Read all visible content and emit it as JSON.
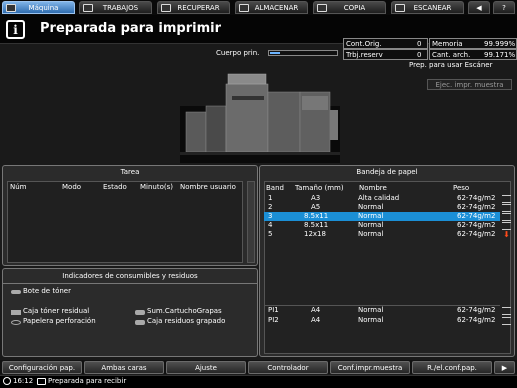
{
  "tabs": [
    {
      "label": "Máquina",
      "icon": "machine-icon"
    },
    {
      "label": "TRABAJOS",
      "icon": "jobs-icon"
    },
    {
      "label": "RECUPERAR",
      "icon": "recall-icon"
    },
    {
      "label": "ALMACENAR",
      "icon": "store-icon"
    },
    {
      "label": "COPIA",
      "icon": "copy-icon"
    },
    {
      "label": "ESCANEAR",
      "icon": "scan-icon"
    }
  ],
  "header": {
    "status": "Preparada para imprimir",
    "body_label": "Cuerpo prin.",
    "body_progress": 0.15,
    "scanner_status": "Prep. para usar Escáner",
    "eject_button": "Ejec. impr. muestra"
  },
  "counters": {
    "cont_orig_label": "Cont.Orig.",
    "cont_orig_value": "0",
    "memoria_label": "Memoria",
    "memoria_value": "99.999%",
    "trbj_label": "Trbj.reserv",
    "trbj_value": "0",
    "cant_label": "Cant. arch.",
    "cant_value": "99.171%"
  },
  "tarea": {
    "title": "Tarea",
    "columns": [
      "Núm",
      "Modo",
      "Estado",
      "Minuto(s)",
      "Nombre usuario"
    ]
  },
  "consumibles": {
    "title": "Indicadores de consumibles y residuos",
    "bote": "Bote de tóner",
    "caja_toner": "Caja tóner residual",
    "papelera": "Papelera perforación",
    "sum_cartucho": "Sum.CartuchoGrapas",
    "caja_residuos": "Caja residuos grapado"
  },
  "bandeja": {
    "title": "Bandeja de papel",
    "columns": [
      "Band",
      "Tamaño (mm)",
      "Nombre",
      "Peso"
    ],
    "rows": [
      {
        "band": "1",
        "size": "A3",
        "name": "Alta calidad",
        "weight": "62-74g/m2"
      },
      {
        "band": "2",
        "size": "A5",
        "name": "Normal",
        "weight": "62-74g/m2"
      },
      {
        "band": "3",
        "size": "8.5x11",
        "name": "Normal",
        "weight": "62-74g/m2"
      },
      {
        "band": "4",
        "size": "8.5x11",
        "name": "Normal",
        "weight": "62-74g/m2"
      },
      {
        "band": "5",
        "size": "12x18",
        "name": "Normal",
        "weight": "62-74g/m2"
      }
    ],
    "pi_rows": [
      {
        "band": "PI1",
        "size": "A4",
        "name": "Normal",
        "weight": "62-74g/m2"
      },
      {
        "band": "PI2",
        "size": "A4",
        "name": "Normal",
        "weight": "62-74g/m2"
      }
    ]
  },
  "bottom_buttons": [
    "Configuración pap.",
    "Ambas caras",
    "Ajuste",
    "Controlador",
    "Conf.impr.muestra",
    "R./el.conf.pap."
  ],
  "status_bar": {
    "time": "16:12",
    "message": "Preparada para recibir"
  },
  "colors": {
    "accent": "#2f6db0",
    "selected_row": "#1b8fd6"
  }
}
